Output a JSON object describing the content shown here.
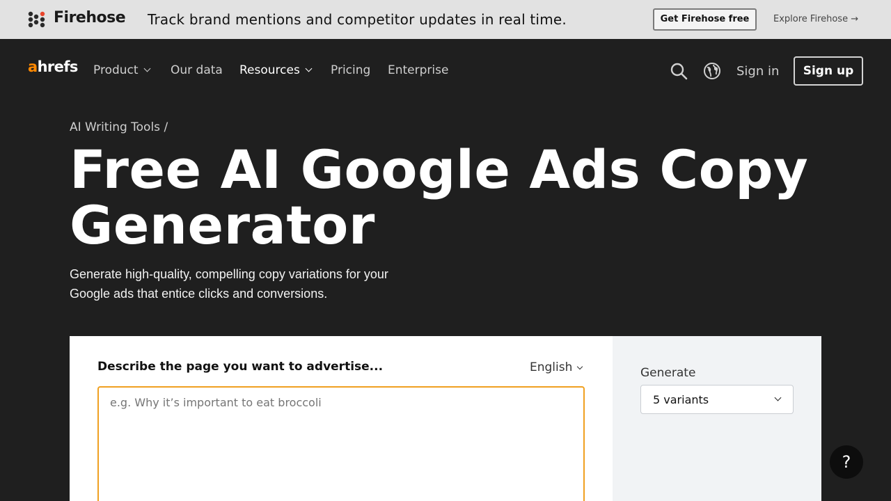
{
  "banner": {
    "brand": "Firehose",
    "message": "Track brand mentions and competitor updates in real time.",
    "cta_label": "Get Firehose free",
    "explore_label": "Explore Firehose →"
  },
  "nav": {
    "logo_accent": "a",
    "logo_rest": "hrefs",
    "items": [
      {
        "label": "Product",
        "has_caret": true
      },
      {
        "label": "Our data",
        "has_caret": false
      },
      {
        "label": "Resources",
        "has_caret": true
      },
      {
        "label": "Pricing",
        "has_caret": false
      },
      {
        "label": "Enterprise",
        "has_caret": false
      }
    ],
    "signin_label": "Sign in",
    "signup_label": "Sign up"
  },
  "hero": {
    "breadcrumb": "AI Writing Tools /",
    "title": "Free AI Google Ads Copy Generator",
    "subtitle": "Generate high-quality, compelling copy variations for your Google ads that entice clicks and conversions."
  },
  "tool": {
    "field_label": "Describe the page you want to advertise...",
    "language": "English",
    "textarea_value": "",
    "textarea_placeholder": "e.g. Why it’s important to eat broccoli",
    "generate_label": "Generate",
    "variants_value": "5 variants"
  },
  "help_label": "?",
  "colors": {
    "accent": "#ff8800",
    "textarea_border": "#f0a020",
    "page_bg": "#1f1f1f",
    "banner_bg": "#e2e2e2"
  }
}
